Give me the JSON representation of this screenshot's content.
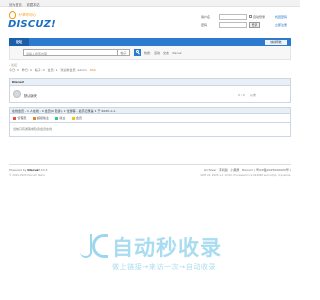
{
  "topbar": {
    "links": [
      "设为首页",
      "收藏本站"
    ]
  },
  "logo": {
    "slogan": "分享你的心",
    "name": "DISCUZ!"
  },
  "login": {
    "username_label": "用户名",
    "password_label": "密码",
    "auto_login_label": "自动登录",
    "find_password_label": "找回密码",
    "login_button": "登录",
    "register_label": "立即注册"
  },
  "nav": {
    "home": "论坛",
    "quick": "快捷导航"
  },
  "search": {
    "placeholder": "请输入搜索内容",
    "type": "帖子",
    "hot_label": "热搜:",
    "hot_items": [
      "活动",
      "交友",
      "discuz"
    ]
  },
  "breadcrumb": {
    "path": "› 论坛",
    "info": [
      "今日: 0",
      "昨日: 0",
      "帖子: 0",
      "会员: 1",
      "欢迎新会员: admin"
    ],
    "rss": "RSS"
  },
  "forum": {
    "category": "Discuz!",
    "name": "默认版块",
    "stats": "0 / 0",
    "lastpost": "从未"
  },
  "stats": {
    "line": "在线会员 - 1 人在线 - 0 会员(0 隐身), 1 位游客 - 最高记录是 1 于 2025-1-1."
  },
  "legend": [
    {
      "label": "管理员",
      "color": "#e74c3c"
    },
    {
      "label": "超级版主",
      "color": "#e67e22"
    },
    {
      "label": "版主",
      "color": "#2ecc71"
    },
    {
      "label": "会员",
      "color": "#f1c40f"
    }
  ],
  "online": {
    "text": "当前只有游客或隐身会员在线"
  },
  "footer": {
    "powered_prefix": "Powered by",
    "powered_brand": "Discuz!",
    "version": "X3.5",
    "copyright": "© 2001-2025 Discuz! Team.",
    "links": [
      "Archiver",
      "手机版",
      "小黑屋",
      "Discuz! ( 粤ICP备2025000000号 )"
    ],
    "gmt": "GMT+8, 2025-1-1 12:00, Processed in 0.024068 second(s), 9 queries."
  },
  "watermark": {
    "title": "自动秒收录",
    "subtitle": "做上链接→来访一次→自动收录"
  }
}
